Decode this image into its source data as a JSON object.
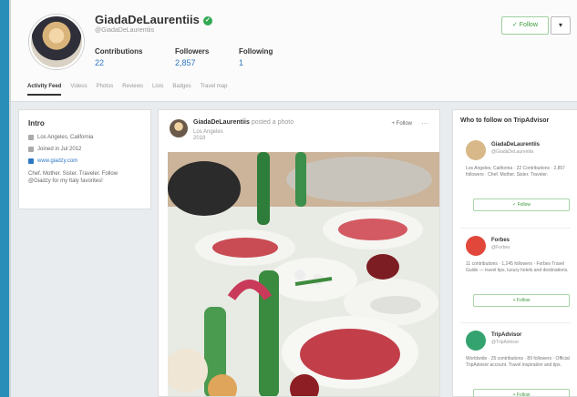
{
  "profile": {
    "name": "GiadaDeLaurentiis",
    "handle": "@GiadaDeLaurentiis",
    "stats": [
      {
        "label": "Contributions",
        "value": "22"
      },
      {
        "label": "Followers",
        "value": "2,857"
      },
      {
        "label": "Following",
        "value": "1"
      }
    ],
    "follow_label": "✓ Follow",
    "more_label": "▾"
  },
  "tabs": [
    "Activity Feed",
    "Videos",
    "Photos",
    "Reviews",
    "Lists",
    "Badges",
    "Travel map"
  ],
  "intro": {
    "title": "Intro",
    "location": "Los Angeles, California",
    "joined": "Joined in Jul 2012",
    "website": "www.giadzy.com",
    "bio": "Chef. Mother. Sister. Traveler. Follow @Giadzy for my Italy favorites!"
  },
  "post": {
    "author": "GiadaDeLaurentiis",
    "action": "posted a photo",
    "sub1": "Los Angeles",
    "sub2": "2018",
    "follow_label": "+ Follow",
    "more": "···"
  },
  "who_to_follow": {
    "title": "Who to follow on TripAdvisor",
    "suggestions": [
      {
        "name": "GiadaDeLaurentiis",
        "handle": "@GiadaDeLaurentiis",
        "desc": "Los Angeles, California · 22 Contributions · 2,857 followers · Chef. Mother. Sister. Traveler.",
        "button": "✓ Follow",
        "avatar_color": "#d8b888"
      },
      {
        "name": "Forbes",
        "handle": "@Forbes",
        "desc": "11 contributions · 1,245 followers · Forbes Travel Guide — travel tips, luxury hotels and destinations.",
        "button": "+ Follow",
        "avatar_color": "#e2473b"
      },
      {
        "name": "TripAdvisor",
        "handle": "@TripAdvisor",
        "desc": "Worldwide · 25 contributions · 89 followers · Official TripAdvisor account. Travel inspiration and tips.",
        "button": "+ Follow",
        "avatar_color": "#34a36f"
      }
    ]
  },
  "colors": {
    "accent": "#2f77c2",
    "brand_green": "#34a853"
  }
}
